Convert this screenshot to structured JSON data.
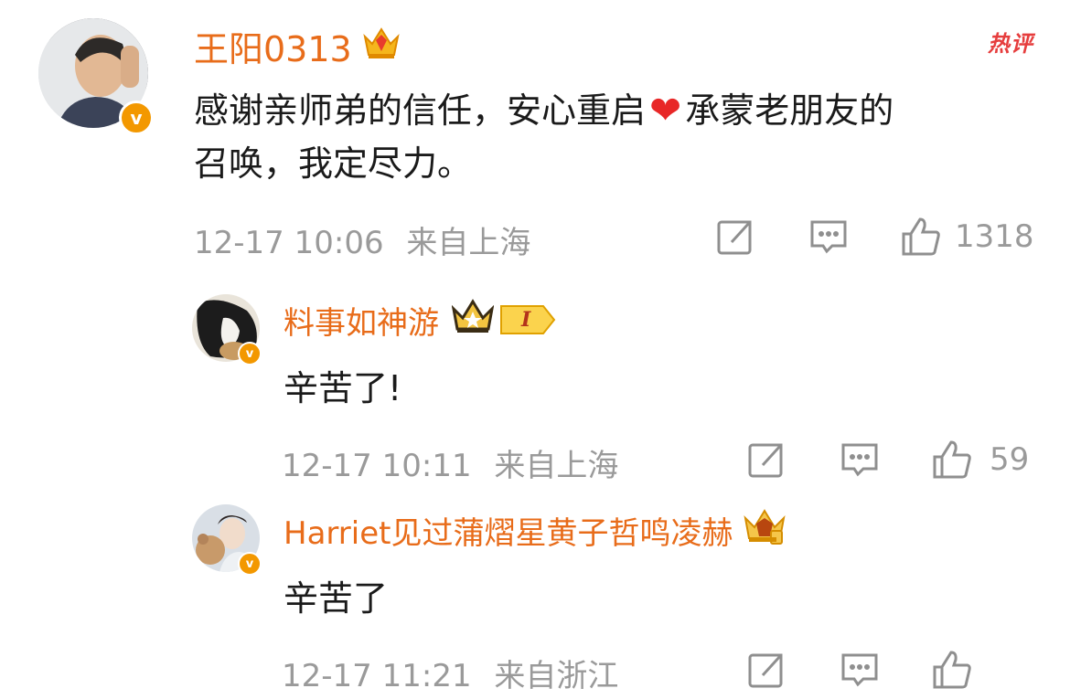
{
  "colors": {
    "username": "#e86c1a",
    "verified": "#f39800",
    "meta": "#9a9a9a",
    "hot": "#e63d3d"
  },
  "hot_label": "热评",
  "comments": [
    {
      "username": "王阳0313",
      "text": "感谢亲师弟的信任，安心重启❤️承蒙老朋友的召唤，我定尽力。",
      "line1": "感谢亲师弟的信任，安心重启",
      "heart": "❤",
      "line1b": "承蒙老朋友的",
      "line2": "召唤，我定尽力。",
      "time": "12-17 10:06",
      "location": "来自上海",
      "likes": "1318",
      "icons": [
        "crown-icon",
        "verified-icon",
        "share-icon",
        "comment-icon",
        "thumbs-up-icon"
      ]
    },
    {
      "username": "料事如神游",
      "text": "辛苦了!",
      "level": "I",
      "time": "12-17 10:11",
      "location": "来自上海",
      "likes": "59",
      "icons": [
        "crown-icon",
        "level-badge",
        "verified-icon",
        "share-icon",
        "comment-icon",
        "thumbs-up-icon"
      ]
    },
    {
      "username": "Harriet见过蒲熠星黄子哲鸣凌赫",
      "text": "辛苦了",
      "time": "12-17 11:21",
      "location": "来自浙江",
      "likes": "",
      "icons": [
        "crown-icon",
        "verified-icon",
        "share-icon",
        "comment-icon",
        "thumbs-up-icon"
      ]
    }
  ]
}
